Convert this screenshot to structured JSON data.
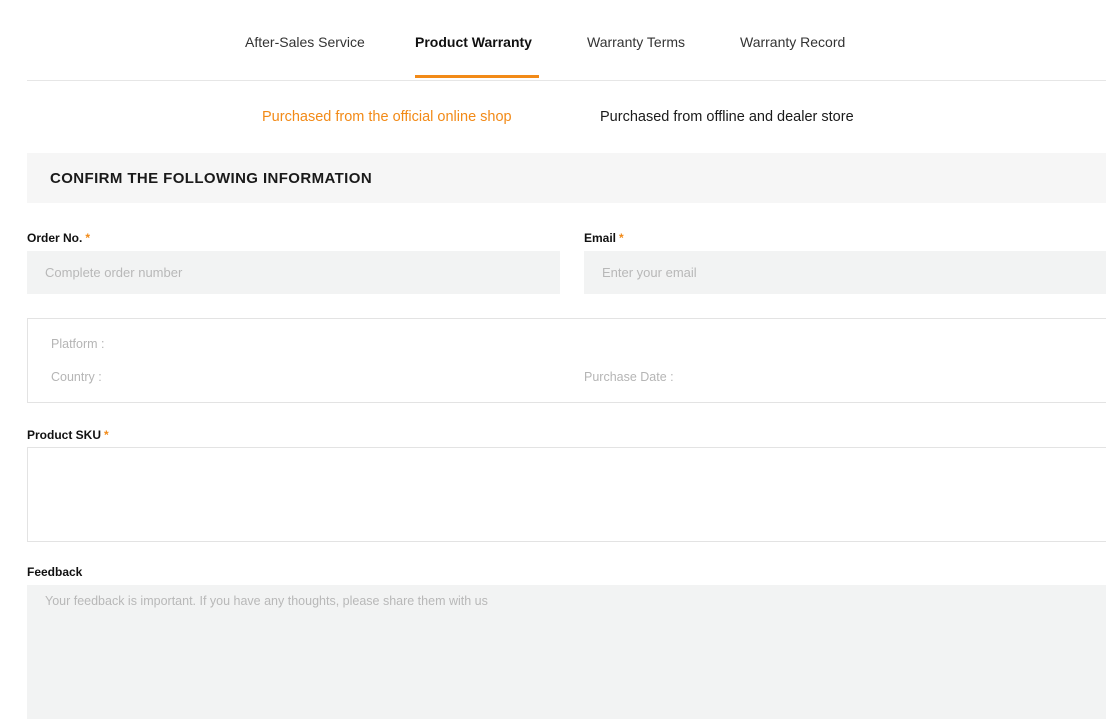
{
  "nav": {
    "tabs": [
      {
        "label": "After-Sales Service",
        "active": false
      },
      {
        "label": "Product Warranty",
        "active": true
      },
      {
        "label": "Warranty Terms",
        "active": false
      },
      {
        "label": "Warranty Record",
        "active": false
      }
    ]
  },
  "purchase_source": {
    "options": [
      {
        "label": "Purchased from the official online shop",
        "active": true
      },
      {
        "label": "Purchased from offline and dealer store",
        "active": false
      }
    ]
  },
  "section": {
    "title": "CONFIRM THE FOLLOWING INFORMATION"
  },
  "form": {
    "order_no": {
      "label": "Order No.",
      "required_mark": "*",
      "placeholder": "Complete order number",
      "value": ""
    },
    "email": {
      "label": "Email",
      "required_mark": "*",
      "placeholder": "Enter your email",
      "value": ""
    },
    "order_info": {
      "platform_label": "Platform :",
      "country_label": "Country :",
      "purchase_date_label": "Purchase Date :"
    },
    "product_sku": {
      "label": "Product SKU",
      "required_mark": "*"
    },
    "feedback": {
      "label": "Feedback",
      "placeholder": "Your feedback is important. If you have any thoughts, please share them with us",
      "value": ""
    }
  },
  "colors": {
    "accent": "#f28a17",
    "input_background": "#f2f3f3",
    "section_background": "#f6f6f6",
    "border": "#e3e3e3"
  }
}
